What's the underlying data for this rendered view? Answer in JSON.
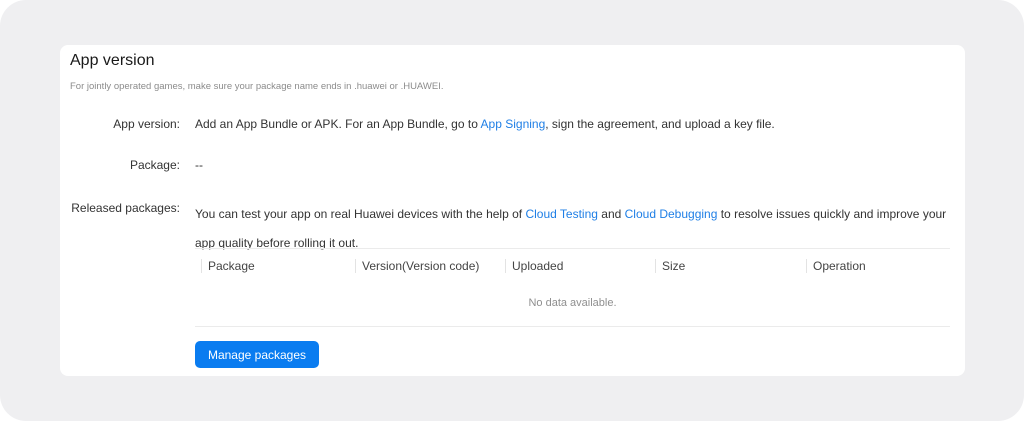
{
  "section": {
    "title": "App version",
    "subtitle": "For jointly operated games, make sure your package name ends in .huawei or .HUAWEI."
  },
  "app_version": {
    "label": "App version:",
    "text_before": "Add an App Bundle or APK. For an App Bundle, go to ",
    "link": "App Signing",
    "text_after": ", sign the agreement, and upload a key file."
  },
  "package": {
    "label": "Package:",
    "value": "--"
  },
  "released": {
    "label": "Released packages:",
    "text_1": "You can test your app on real Huawei devices with the help of ",
    "link_1": "Cloud Testing",
    "text_2": " and ",
    "link_2": "Cloud Debugging",
    "text_3": " to resolve issues quickly and improve your app quality before rolling it out."
  },
  "table": {
    "columns": [
      "Package",
      "Version(Version code)",
      "Uploaded",
      "Size",
      "Operation"
    ],
    "empty_text": "No data available."
  },
  "manage_button": "Manage packages"
}
